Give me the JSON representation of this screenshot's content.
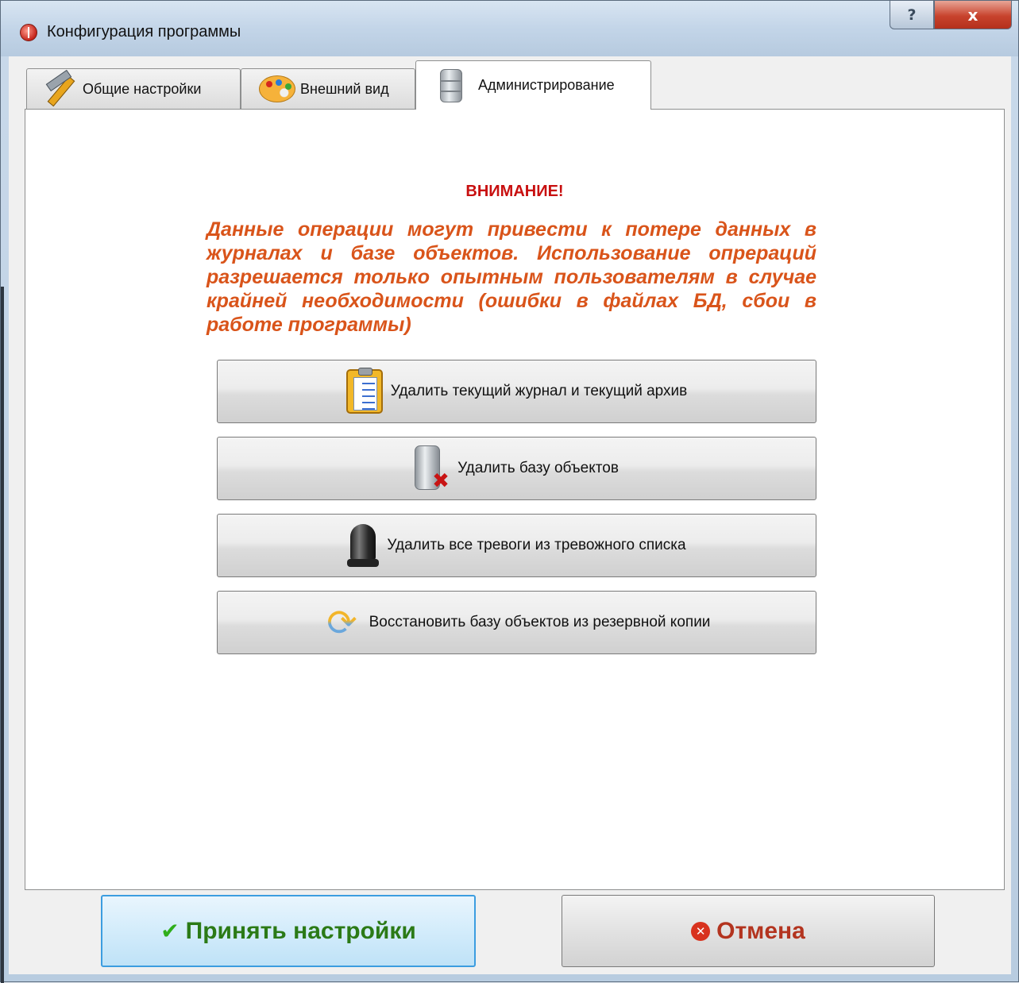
{
  "window": {
    "title": "Конфигурация программы",
    "help_glyph": "?",
    "close_glyph": "x"
  },
  "tabs": [
    {
      "label": "Общие настройки",
      "icon": "tools-icon"
    },
    {
      "label": "Внешний вид",
      "icon": "palette-icon"
    },
    {
      "label": "Администрирование",
      "icon": "database-icon",
      "active": true
    }
  ],
  "warning": {
    "title": "ВНИМАНИЕ!",
    "text": "Данные операции могут привести к потере данных в журналах и базе объектов. Использование опрераций разрешается только опытным пользователям в случае крайней необходимости (ошибки в файлах БД, сбои в работе программы)",
    "title_color": "#c81010",
    "text_color": "#d9541a"
  },
  "actions": [
    {
      "label": "Удалить текущий журнал и текущий архив",
      "icon": "clipboard-icon"
    },
    {
      "label": "Удалить базу объектов",
      "icon": "database-delete-icon"
    },
    {
      "label": "Удалить все тревоги из тревожного списка",
      "icon": "siren-icon"
    },
    {
      "label": "Восстановить базу объектов из резервной копии",
      "icon": "refresh-icon"
    }
  ],
  "footer": {
    "accept_label": "Принять настройки",
    "cancel_label": "Отмена",
    "accept_color": "#2b7a16",
    "cancel_color": "#b3341f"
  }
}
